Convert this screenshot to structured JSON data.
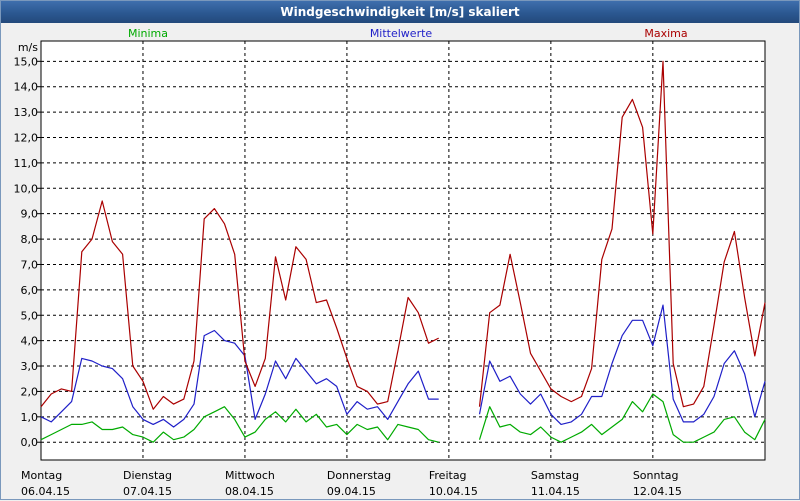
{
  "window": {
    "title": "Windgeschwindigkeit [m/s] skaliert"
  },
  "chart_data": {
    "type": "line",
    "title": "Windgeschwindigkeit [m/s] skaliert",
    "ylabel": "m/s",
    "ylim": [
      -0.7,
      15.8
    ],
    "y_ticks": [
      "0,0",
      "1,0",
      "2,0",
      "3,0",
      "4,0",
      "5,0",
      "6,0",
      "7,0",
      "8,0",
      "9,0",
      "10,0",
      "11,0",
      "12,0",
      "13,0",
      "14,0",
      "15,0"
    ],
    "x_days": [
      {
        "name": "Montag",
        "date": "06.04.15"
      },
      {
        "name": "Dienstag",
        "date": "07.04.15"
      },
      {
        "name": "Mittwoch",
        "date": "08.04.15"
      },
      {
        "name": "Donnerstag",
        "date": "09.04.15"
      },
      {
        "name": "Freitag",
        "date": "10.04.15"
      },
      {
        "name": "Samstag",
        "date": "11.04.15"
      },
      {
        "name": "Sonntag",
        "date": "12.04.15"
      }
    ],
    "x_range_days": [
      0,
      7.1
    ],
    "grid": true,
    "colors": {
      "Minima": "#00aa00",
      "Mittelwerte": "#1f1fc8",
      "Maxima": "#aa0000"
    },
    "series": [
      {
        "name": "Minima",
        "segments": [
          [
            [
              0.0,
              0.1
            ],
            [
              0.1,
              0.3
            ],
            [
              0.2,
              0.5
            ],
            [
              0.3,
              0.7
            ],
            [
              0.4,
              0.7
            ],
            [
              0.5,
              0.8
            ],
            [
              0.6,
              0.5
            ],
            [
              0.7,
              0.5
            ],
            [
              0.8,
              0.6
            ],
            [
              0.9,
              0.3
            ],
            [
              1.0,
              0.2
            ],
            [
              1.1,
              0.0
            ],
            [
              1.2,
              0.4
            ],
            [
              1.3,
              0.1
            ],
            [
              1.4,
              0.2
            ],
            [
              1.5,
              0.5
            ],
            [
              1.6,
              1.0
            ],
            [
              1.7,
              1.2
            ],
            [
              1.8,
              1.4
            ],
            [
              1.9,
              0.9
            ],
            [
              2.0,
              0.2
            ],
            [
              2.1,
              0.4
            ],
            [
              2.2,
              0.9
            ],
            [
              2.3,
              1.2
            ],
            [
              2.4,
              0.8
            ],
            [
              2.5,
              1.3
            ],
            [
              2.6,
              0.8
            ],
            [
              2.7,
              1.1
            ],
            [
              2.8,
              0.6
            ],
            [
              2.9,
              0.7
            ],
            [
              3.0,
              0.3
            ],
            [
              3.1,
              0.7
            ],
            [
              3.2,
              0.5
            ],
            [
              3.3,
              0.6
            ],
            [
              3.4,
              0.1
            ],
            [
              3.5,
              0.7
            ],
            [
              3.6,
              0.6
            ],
            [
              3.7,
              0.5
            ],
            [
              3.8,
              0.1
            ],
            [
              3.9,
              0.0
            ]
          ],
          [
            [
              4.3,
              0.1
            ],
            [
              4.4,
              1.4
            ],
            [
              4.5,
              0.6
            ],
            [
              4.6,
              0.7
            ],
            [
              4.7,
              0.4
            ],
            [
              4.8,
              0.3
            ],
            [
              4.9,
              0.6
            ],
            [
              5.0,
              0.2
            ],
            [
              5.1,
              0.0
            ],
            [
              5.2,
              0.2
            ],
            [
              5.3,
              0.4
            ],
            [
              5.4,
              0.7
            ],
            [
              5.5,
              0.3
            ],
            [
              5.6,
              0.6
            ],
            [
              5.7,
              0.9
            ],
            [
              5.8,
              1.6
            ],
            [
              5.9,
              1.2
            ],
            [
              6.0,
              1.9
            ],
            [
              6.1,
              1.6
            ],
            [
              6.2,
              0.3
            ],
            [
              6.3,
              0.0
            ],
            [
              6.4,
              0.0
            ],
            [
              6.5,
              0.2
            ],
            [
              6.6,
              0.4
            ],
            [
              6.7,
              0.9
            ],
            [
              6.8,
              1.0
            ],
            [
              6.9,
              0.4
            ],
            [
              7.0,
              0.1
            ],
            [
              7.1,
              0.9
            ]
          ]
        ]
      },
      {
        "name": "Mittelwerte",
        "segments": [
          [
            [
              0.0,
              1.0
            ],
            [
              0.1,
              0.8
            ],
            [
              0.2,
              1.2
            ],
            [
              0.3,
              1.6
            ],
            [
              0.4,
              3.3
            ],
            [
              0.5,
              3.2
            ],
            [
              0.6,
              3.0
            ],
            [
              0.7,
              2.9
            ],
            [
              0.8,
              2.5
            ],
            [
              0.9,
              1.4
            ],
            [
              1.0,
              0.9
            ],
            [
              1.1,
              0.7
            ],
            [
              1.2,
              0.9
            ],
            [
              1.3,
              0.6
            ],
            [
              1.4,
              0.9
            ],
            [
              1.5,
              1.5
            ],
            [
              1.6,
              4.2
            ],
            [
              1.7,
              4.4
            ],
            [
              1.8,
              4.0
            ],
            [
              1.9,
              3.9
            ],
            [
              2.0,
              3.4
            ],
            [
              2.1,
              0.9
            ],
            [
              2.2,
              1.9
            ],
            [
              2.3,
              3.2
            ],
            [
              2.4,
              2.5
            ],
            [
              2.5,
              3.3
            ],
            [
              2.6,
              2.8
            ],
            [
              2.7,
              2.3
            ],
            [
              2.8,
              2.5
            ],
            [
              2.9,
              2.2
            ],
            [
              3.0,
              1.1
            ],
            [
              3.1,
              1.6
            ],
            [
              3.2,
              1.3
            ],
            [
              3.3,
              1.4
            ],
            [
              3.4,
              0.9
            ],
            [
              3.5,
              1.6
            ],
            [
              3.6,
              2.3
            ],
            [
              3.7,
              2.8
            ],
            [
              3.8,
              1.7
            ],
            [
              3.9,
              1.7
            ]
          ],
          [
            [
              4.3,
              1.1
            ],
            [
              4.4,
              3.2
            ],
            [
              4.5,
              2.4
            ],
            [
              4.6,
              2.6
            ],
            [
              4.7,
              1.9
            ],
            [
              4.8,
              1.5
            ],
            [
              4.9,
              1.9
            ],
            [
              5.0,
              1.1
            ],
            [
              5.1,
              0.7
            ],
            [
              5.2,
              0.8
            ],
            [
              5.3,
              1.1
            ],
            [
              5.4,
              1.8
            ],
            [
              5.5,
              1.8
            ],
            [
              5.6,
              3.1
            ],
            [
              5.7,
              4.2
            ],
            [
              5.8,
              4.8
            ],
            [
              5.9,
              4.8
            ],
            [
              6.0,
              3.8
            ],
            [
              6.1,
              5.4
            ],
            [
              6.2,
              1.7
            ],
            [
              6.3,
              0.8
            ],
            [
              6.4,
              0.8
            ],
            [
              6.5,
              1.1
            ],
            [
              6.6,
              1.8
            ],
            [
              6.7,
              3.1
            ],
            [
              6.8,
              3.6
            ],
            [
              6.9,
              2.7
            ],
            [
              7.0,
              1.0
            ],
            [
              7.1,
              2.4
            ]
          ]
        ]
      },
      {
        "name": "Maxima",
        "segments": [
          [
            [
              0.0,
              1.4
            ],
            [
              0.1,
              1.9
            ],
            [
              0.2,
              2.1
            ],
            [
              0.3,
              2.0
            ],
            [
              0.4,
              7.5
            ],
            [
              0.5,
              8.0
            ],
            [
              0.6,
              9.5
            ],
            [
              0.7,
              7.9
            ],
            [
              0.8,
              7.4
            ],
            [
              0.9,
              3.0
            ],
            [
              1.0,
              2.4
            ],
            [
              1.1,
              1.3
            ],
            [
              1.2,
              1.8
            ],
            [
              1.3,
              1.5
            ],
            [
              1.4,
              1.7
            ],
            [
              1.5,
              3.2
            ],
            [
              1.6,
              8.8
            ],
            [
              1.7,
              9.2
            ],
            [
              1.8,
              8.6
            ],
            [
              1.9,
              7.4
            ],
            [
              2.0,
              3.2
            ],
            [
              2.1,
              2.2
            ],
            [
              2.2,
              3.3
            ],
            [
              2.3,
              7.3
            ],
            [
              2.4,
              5.6
            ],
            [
              2.5,
              7.7
            ],
            [
              2.6,
              7.2
            ],
            [
              2.7,
              5.5
            ],
            [
              2.8,
              5.6
            ],
            [
              2.9,
              4.5
            ],
            [
              3.0,
              3.3
            ],
            [
              3.1,
              2.2
            ],
            [
              3.2,
              2.0
            ],
            [
              3.3,
              1.5
            ],
            [
              3.4,
              1.6
            ],
            [
              3.5,
              3.6
            ],
            [
              3.6,
              5.7
            ],
            [
              3.7,
              5.1
            ],
            [
              3.8,
              3.9
            ],
            [
              3.9,
              4.1
            ]
          ],
          [
            [
              4.3,
              1.4
            ],
            [
              4.4,
              5.1
            ],
            [
              4.5,
              5.4
            ],
            [
              4.6,
              7.4
            ],
            [
              4.7,
              5.5
            ],
            [
              4.8,
              3.5
            ],
            [
              4.9,
              2.8
            ],
            [
              5.0,
              2.1
            ],
            [
              5.1,
              1.8
            ],
            [
              5.2,
              1.6
            ],
            [
              5.3,
              1.8
            ],
            [
              5.4,
              2.9
            ],
            [
              5.5,
              7.2
            ],
            [
              5.6,
              8.4
            ],
            [
              5.7,
              12.8
            ],
            [
              5.8,
              13.5
            ],
            [
              5.9,
              12.4
            ],
            [
              6.0,
              8.2
            ],
            [
              6.1,
              15.0
            ],
            [
              6.2,
              3.1
            ],
            [
              6.3,
              1.4
            ],
            [
              6.4,
              1.5
            ],
            [
              6.5,
              2.2
            ],
            [
              6.6,
              4.6
            ],
            [
              6.7,
              7.1
            ],
            [
              6.8,
              8.3
            ],
            [
              6.9,
              5.7
            ],
            [
              7.0,
              3.4
            ],
            [
              7.1,
              5.5
            ]
          ]
        ]
      }
    ]
  }
}
